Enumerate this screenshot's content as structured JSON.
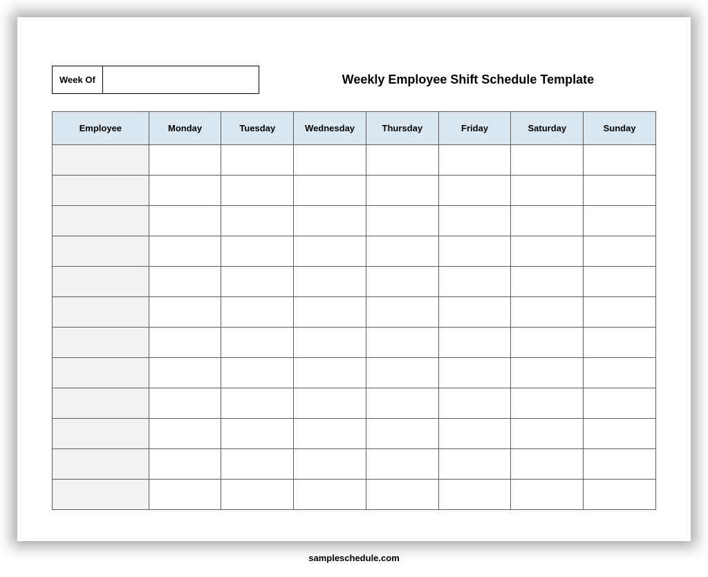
{
  "header": {
    "week_of_label": "Week Of",
    "week_of_value": "",
    "title": "Weekly Employee Shift Schedule Template"
  },
  "table": {
    "columns": [
      "Employee",
      "Monday",
      "Tuesday",
      "Wednesday",
      "Thursday",
      "Friday",
      "Saturday",
      "Sunday"
    ],
    "rows": [
      {
        "employee": "",
        "monday": "",
        "tuesday": "",
        "wednesday": "",
        "thursday": "",
        "friday": "",
        "saturday": "",
        "sunday": ""
      },
      {
        "employee": "",
        "monday": "",
        "tuesday": "",
        "wednesday": "",
        "thursday": "",
        "friday": "",
        "saturday": "",
        "sunday": ""
      },
      {
        "employee": "",
        "monday": "",
        "tuesday": "",
        "wednesday": "",
        "thursday": "",
        "friday": "",
        "saturday": "",
        "sunday": ""
      },
      {
        "employee": "",
        "monday": "",
        "tuesday": "",
        "wednesday": "",
        "thursday": "",
        "friday": "",
        "saturday": "",
        "sunday": ""
      },
      {
        "employee": "",
        "monday": "",
        "tuesday": "",
        "wednesday": "",
        "thursday": "",
        "friday": "",
        "saturday": "",
        "sunday": ""
      },
      {
        "employee": "",
        "monday": "",
        "tuesday": "",
        "wednesday": "",
        "thursday": "",
        "friday": "",
        "saturday": "",
        "sunday": ""
      },
      {
        "employee": "",
        "monday": "",
        "tuesday": "",
        "wednesday": "",
        "thursday": "",
        "friday": "",
        "saturday": "",
        "sunday": ""
      },
      {
        "employee": "",
        "monday": "",
        "tuesday": "",
        "wednesday": "",
        "thursday": "",
        "friday": "",
        "saturday": "",
        "sunday": ""
      },
      {
        "employee": "",
        "monday": "",
        "tuesday": "",
        "wednesday": "",
        "thursday": "",
        "friday": "",
        "saturday": "",
        "sunday": ""
      },
      {
        "employee": "",
        "monday": "",
        "tuesday": "",
        "wednesday": "",
        "thursday": "",
        "friday": "",
        "saturday": "",
        "sunday": ""
      },
      {
        "employee": "",
        "monday": "",
        "tuesday": "",
        "wednesday": "",
        "thursday": "",
        "friday": "",
        "saturday": "",
        "sunday": ""
      },
      {
        "employee": "",
        "monday": "",
        "tuesday": "",
        "wednesday": "",
        "thursday": "",
        "friday": "",
        "saturday": "",
        "sunday": ""
      }
    ]
  },
  "footer": {
    "text": "sampleschedule.com"
  }
}
